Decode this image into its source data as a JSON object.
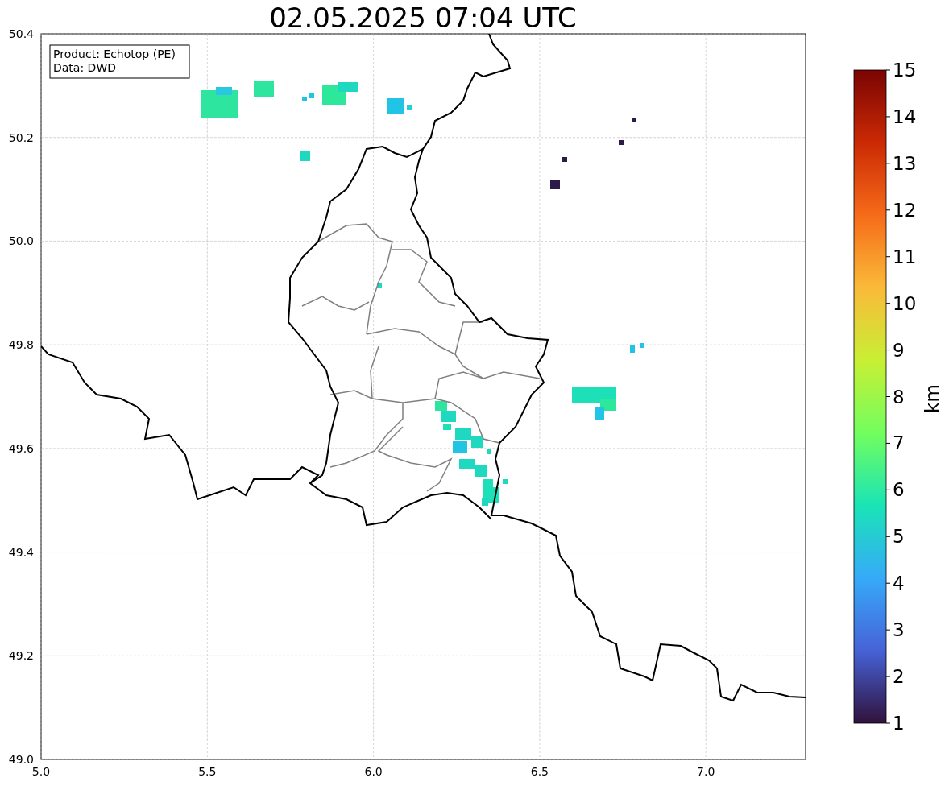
{
  "title": "02.05.2025 07:04 UTC",
  "legend": [
    "Product: Echotop (PE)",
    "Data: DWD"
  ],
  "x_ticks": [
    "5.0",
    "5.5",
    "6.0",
    "6.5",
    "7.0"
  ],
  "y_ticks": [
    "50.4",
    "50.2",
    "50.0",
    "49.8",
    "49.6",
    "49.4",
    "49.2",
    "49.0"
  ],
  "colorbar": {
    "label": "km",
    "ticks": [
      "15",
      "14",
      "13",
      "12",
      "11",
      "10",
      "9",
      "8",
      "7",
      "6",
      "5",
      "4",
      "3",
      "2",
      "1"
    ]
  }
}
